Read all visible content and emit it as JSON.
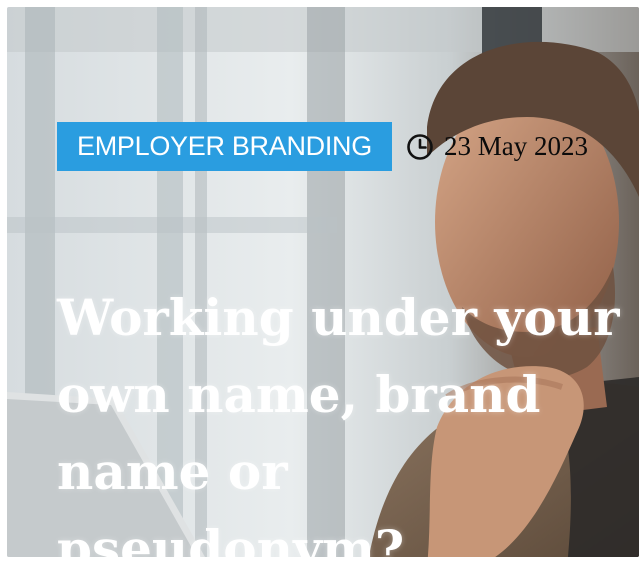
{
  "post": {
    "category": "EMPLOYER BRANDING",
    "date": "23 May 2023",
    "title": "Working under your own name, brand name or pseudonym?"
  },
  "icons": {
    "date": "clock-icon"
  },
  "colors": {
    "category_bg": "#2a9de0",
    "category_text": "#ffffff",
    "date_text": "#0b0b0b",
    "title_text": "#ffffff"
  }
}
